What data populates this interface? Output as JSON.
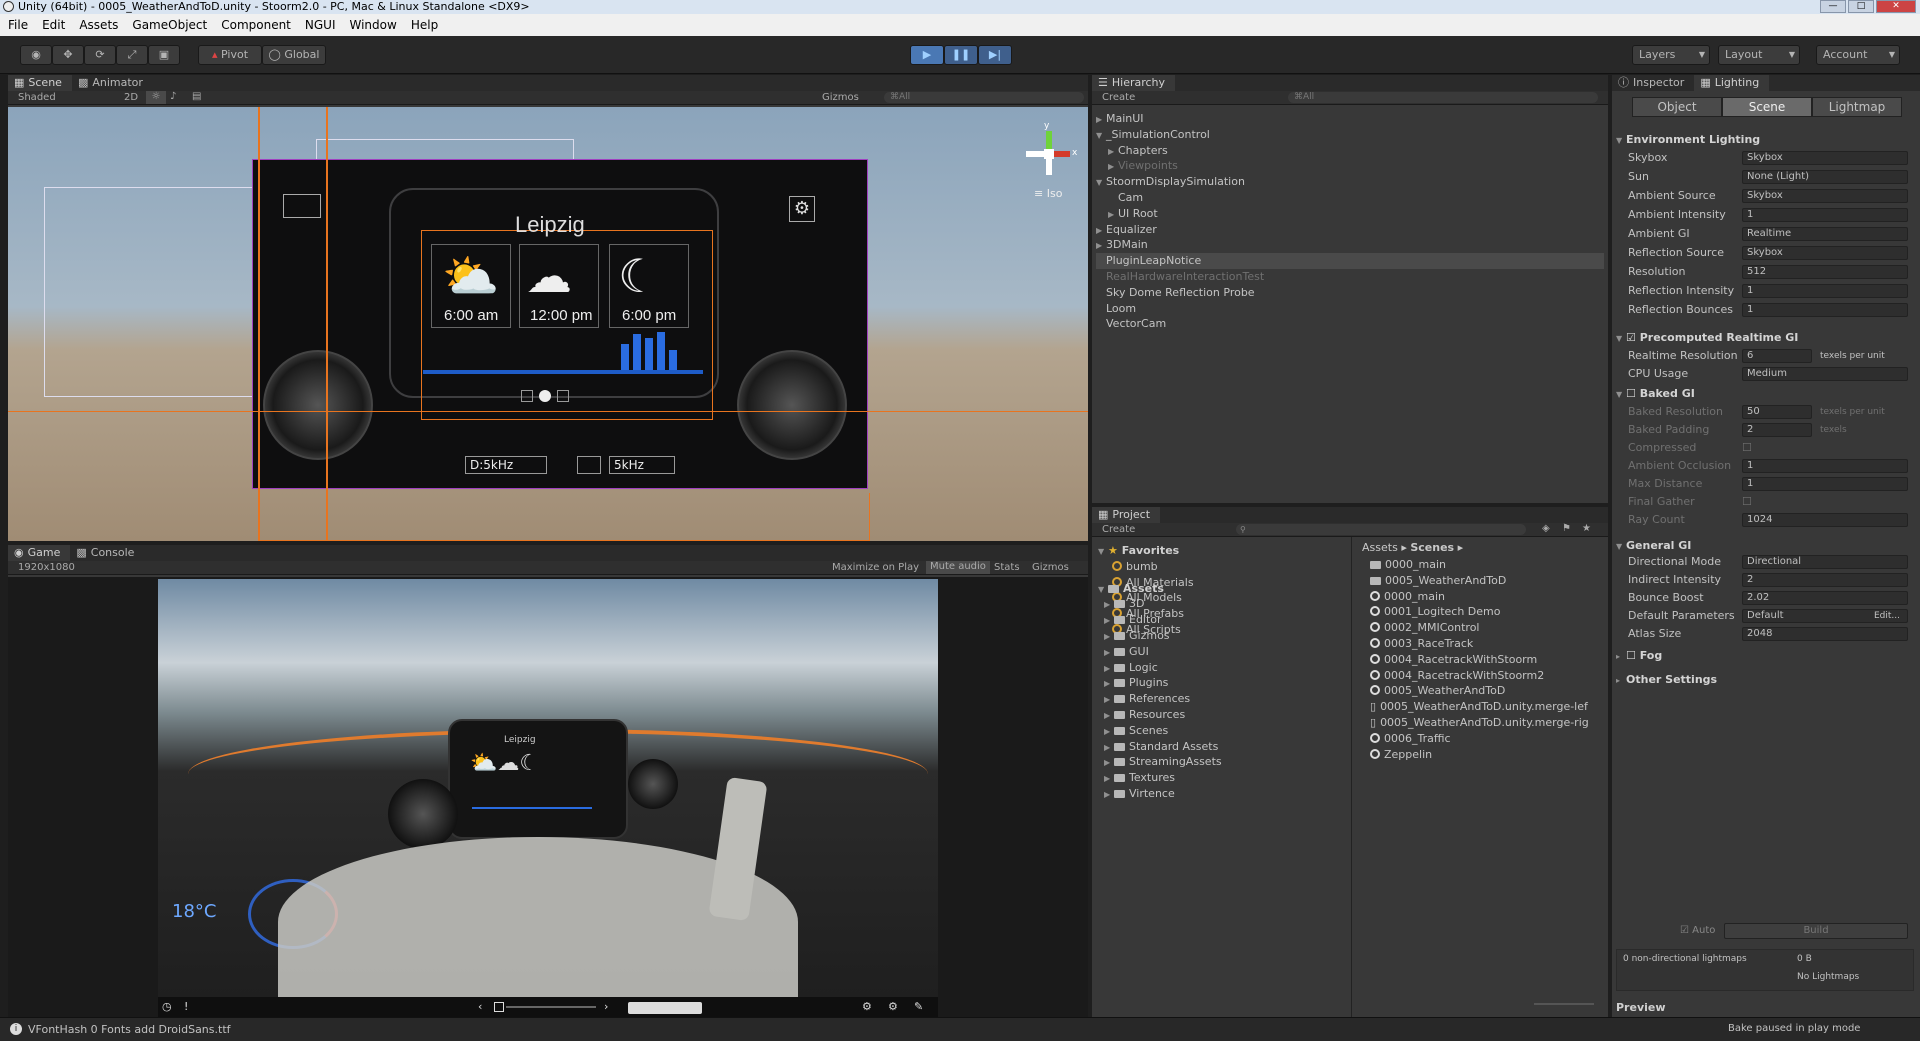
{
  "window": {
    "title": "Unity (64bit) - 0005_WeatherAndToD.unity - Stoorm2.0 - PC, Mac & Linux Standalone <DX9>"
  },
  "menu": [
    "File",
    "Edit",
    "Assets",
    "GameObject",
    "Component",
    "NGUI",
    "Window",
    "Help"
  ],
  "toolbar": {
    "pivot": "Pivot",
    "global": "Global",
    "layers": "Layers",
    "layout": "Layout",
    "account": "Account"
  },
  "scene": {
    "tab": "Scene",
    "animator_tab": "Animator",
    "shading": "Shaded",
    "mode2d": "2D",
    "gizmos": "Gizmos",
    "search": "⌘All",
    "iso": "Iso",
    "city": "Leipzig",
    "times": [
      "6:00 am",
      "12:00 pm",
      "6:00 pm"
    ],
    "freq1": "D:5kHz",
    "freq2": "5kHz"
  },
  "game": {
    "tab": "Game",
    "console_tab": "Console",
    "resolution": "1920x1080",
    "maximize": "Maximize on Play",
    "mute": "Mute audio",
    "stats": "Stats",
    "gizmos": "Gizmos"
  },
  "hierarchy": {
    "tab": "Hierarchy",
    "create": "Create",
    "search": "⌘All",
    "items": [
      {
        "label": "MainUI",
        "indent": 0,
        "arrow": true,
        "dim": false
      },
      {
        "label": "_SimulationControl",
        "indent": 0,
        "arrow": true,
        "dim": false,
        "open": true
      },
      {
        "label": "Chapters",
        "indent": 1,
        "arrow": true,
        "dim": false
      },
      {
        "label": "Viewpoints",
        "indent": 1,
        "arrow": true,
        "dim": true
      },
      {
        "label": "StoormDisplaySimulation",
        "indent": 0,
        "arrow": true,
        "dim": false,
        "open": true
      },
      {
        "label": "Cam",
        "indent": 1,
        "arrow": false,
        "dim": false
      },
      {
        "label": "UI Root",
        "indent": 1,
        "arrow": true,
        "dim": false
      },
      {
        "label": "Equalizer",
        "indent": 0,
        "arrow": true,
        "dim": false
      },
      {
        "label": "3DMain",
        "indent": 0,
        "arrow": true,
        "dim": false
      },
      {
        "label": "PluginLeapNotice",
        "indent": 0,
        "arrow": false,
        "dim": false,
        "selected": true
      },
      {
        "label": "RealHardwareInteractionTest",
        "indent": 0,
        "arrow": false,
        "dim": true
      },
      {
        "label": "Sky Dome Reflection Probe",
        "indent": 0,
        "arrow": false,
        "dim": false
      },
      {
        "label": "Loom",
        "indent": 0,
        "arrow": false,
        "dim": false
      },
      {
        "label": "VectorCam",
        "indent": 0,
        "arrow": false,
        "dim": false
      }
    ]
  },
  "project": {
    "tab": "Project",
    "create": "Create",
    "favorites_label": "Favorites",
    "assets_label": "Assets",
    "favorites": [
      "bumb",
      "All Materials",
      "All Models",
      "All Prefabs",
      "All Scripts"
    ],
    "folders": [
      "3D",
      "Editor",
      "Gizmos",
      "GUI",
      "Logic",
      "Plugins",
      "References",
      "Resources",
      "Scenes",
      "Standard Assets",
      "StreamingAssets",
      "Textures",
      "Virtence"
    ],
    "breadcrumb": [
      "Assets",
      "Scenes"
    ],
    "files": [
      {
        "label": "0000_main",
        "type": "folder"
      },
      {
        "label": "0005_WeatherAndToD",
        "type": "folder"
      },
      {
        "label": "0000_main",
        "type": "scene"
      },
      {
        "label": "0001_Logitech Demo",
        "type": "scene"
      },
      {
        "label": "0002_MMIControl",
        "type": "scene"
      },
      {
        "label": "0003_RaceTrack",
        "type": "scene"
      },
      {
        "label": "0004_RacetrackWithStoorm",
        "type": "scene"
      },
      {
        "label": "0004_RacetrackWithStoorm2",
        "type": "scene"
      },
      {
        "label": "0005_WeatherAndToD",
        "type": "scene"
      },
      {
        "label": "0005_WeatherAndToD.unity.merge-lef",
        "type": "file"
      },
      {
        "label": "0005_WeatherAndToD.unity.merge-rig",
        "type": "file"
      },
      {
        "label": "0006_Traffic",
        "type": "scene"
      },
      {
        "label": "Zeppelin",
        "type": "scene"
      }
    ]
  },
  "inspector": {
    "tab": "Inspector",
    "lighting_tab": "Lighting",
    "subtabs": [
      "Object",
      "Scene",
      "Lightmap"
    ],
    "env_title": "Environment Lighting",
    "rows": [
      {
        "label": "Skybox",
        "value": "Skybox"
      },
      {
        "label": "Sun",
        "value": "None (Light)"
      },
      {
        "label": "Ambient Source",
        "value": "Skybox"
      },
      {
        "label": "Ambient Intensity",
        "value": "1"
      },
      {
        "label": "Ambient GI",
        "value": "Realtime"
      },
      {
        "label": "Reflection Source",
        "value": "Skybox"
      },
      {
        "label": "Resolution",
        "value": "512"
      },
      {
        "label": "Reflection Intensity",
        "value": "1"
      },
      {
        "label": "Reflection Bounces",
        "value": "1"
      }
    ],
    "precomputed_title": "Precomputed Realtime GI",
    "precomputed_rows": [
      {
        "label": "Realtime Resolution",
        "value": "6",
        "unit": "texels per unit"
      },
      {
        "label": "CPU Usage",
        "value": "Medium"
      }
    ],
    "baked_title": "Baked GI",
    "baked_rows": [
      {
        "label": "Baked Resolution",
        "value": "50",
        "unit": "texels per unit"
      },
      {
        "label": "Baked Padding",
        "value": "2",
        "unit": "texels"
      },
      {
        "label": "Compressed",
        "value": ""
      },
      {
        "label": "Ambient Occlusion",
        "value": "1"
      },
      {
        "label": "Max Distance",
        "value": "1"
      },
      {
        "label": "Final Gather",
        "value": ""
      },
      {
        "label": "Ray Count",
        "value": "1024"
      }
    ],
    "general_title": "General GI",
    "general_rows": [
      {
        "label": "Directional Mode",
        "value": "Directional"
      },
      {
        "label": "Indirect Intensity",
        "value": "2"
      },
      {
        "label": "Bounce Boost",
        "value": "2.02"
      },
      {
        "label": "Default Parameters",
        "value": "Default",
        "extra": "Edit..."
      },
      {
        "label": "Atlas Size",
        "value": "2048"
      }
    ],
    "fog": "Fog",
    "other": "Other Settings",
    "auto": "Auto",
    "build": "Build",
    "lightmaps": "0 non-directional lightmaps",
    "size": "0 B",
    "nolightmaps": "No Lightmaps",
    "preview": "Preview",
    "bake_status": "Bake paused in play mode"
  },
  "status": {
    "message": "VFontHash 0 Fonts add DroidSans.ttf"
  }
}
